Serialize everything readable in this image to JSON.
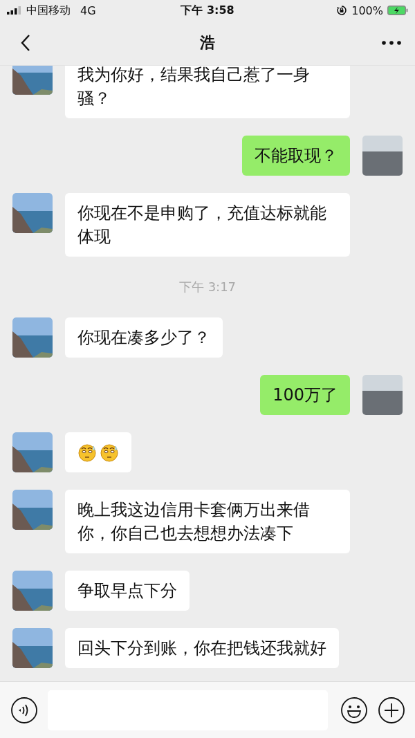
{
  "status_bar": {
    "carrier": "中国移动",
    "network": "4G",
    "time": "下午 3:58",
    "battery": "100%"
  },
  "nav": {
    "title": "浩"
  },
  "messages": [
    {
      "kind": "text",
      "outgoing": false,
      "text": "我为你好，结果我自己惹了一身骚？"
    },
    {
      "kind": "text",
      "outgoing": true,
      "text": "不能取现？"
    },
    {
      "kind": "text",
      "outgoing": false,
      "text": "你现在不是申购了，充值达标就能体现"
    },
    {
      "kind": "time",
      "text": "下午 3:17"
    },
    {
      "kind": "text",
      "outgoing": false,
      "text": "你现在凑多少了？"
    },
    {
      "kind": "text",
      "outgoing": true,
      "text": "100万了"
    },
    {
      "kind": "stickers",
      "outgoing": false,
      "stickers": [
        {
          "kind": "sweat"
        },
        {
          "kind": "sweat"
        }
      ]
    },
    {
      "kind": "text",
      "outgoing": false,
      "text": "晚上我这边信用卡套俩万出来借你，你自己也去想想办法凑下"
    },
    {
      "kind": "text",
      "outgoing": false,
      "text": "争取早点下分"
    },
    {
      "kind": "text",
      "outgoing": false,
      "text": "回头下分到账，你在把钱还我就好"
    }
  ]
}
